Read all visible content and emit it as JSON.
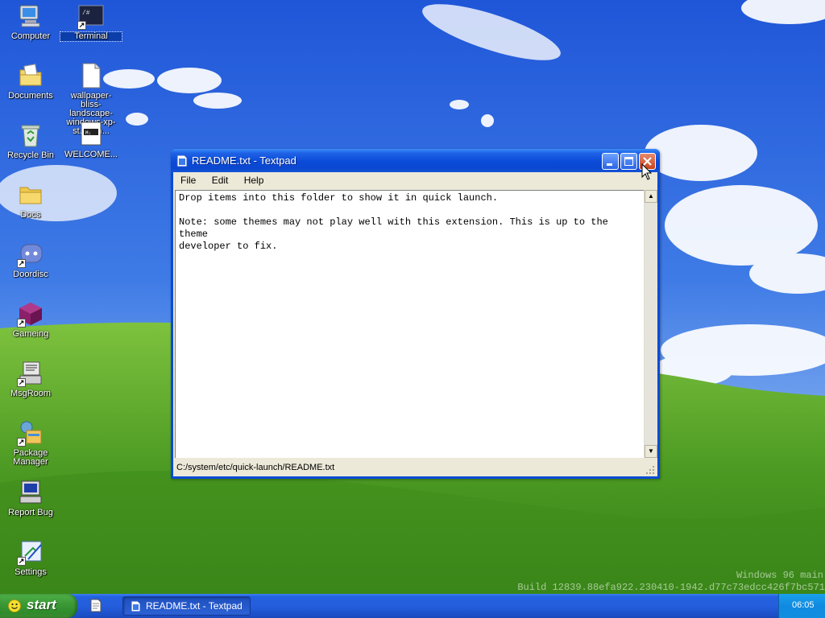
{
  "desktop": {
    "icons": [
      {
        "label": "Computer"
      },
      {
        "label": "Documents"
      },
      {
        "label": "Recycle Bin"
      },
      {
        "label": "Docs"
      },
      {
        "label": "Doordisc"
      },
      {
        "label": "Gameing"
      },
      {
        "label": "MsgRoom"
      },
      {
        "label": "Package Manager"
      },
      {
        "label": "Report Bug"
      },
      {
        "label": "Settings"
      },
      {
        "label": "Terminal"
      },
      {
        "label": "wallpaper-bliss-landscape-windows-xp-st...-k-n..."
      },
      {
        "label": "WELCOME..."
      }
    ]
  },
  "window": {
    "title": "README.txt - Textpad",
    "menu": [
      "File",
      "Edit",
      "Help"
    ],
    "content": "Drop items into this folder to show it in quick launch.\n\nNote: some themes may not play well with this extension. This is up to the theme\ndeveloper to fix.",
    "status_path": "C:/system/etc/quick-launch/README.txt"
  },
  "watermark": {
    "line1": "Windows 96 main",
    "line2": "Build 12839.88efa922.230410-1942.d77c73edcc426f7bc571"
  },
  "taskbar": {
    "start_label": "start",
    "task_label": "README.txt - Textpad",
    "clock": "06:05"
  },
  "colors": {
    "titlebar": "#0a4ad8",
    "taskbar": "#245edc",
    "start_button": "#3c9a36",
    "tray": "#0f8ae0",
    "sky": "#2a64d6",
    "hills": "#4f9a2a"
  }
}
